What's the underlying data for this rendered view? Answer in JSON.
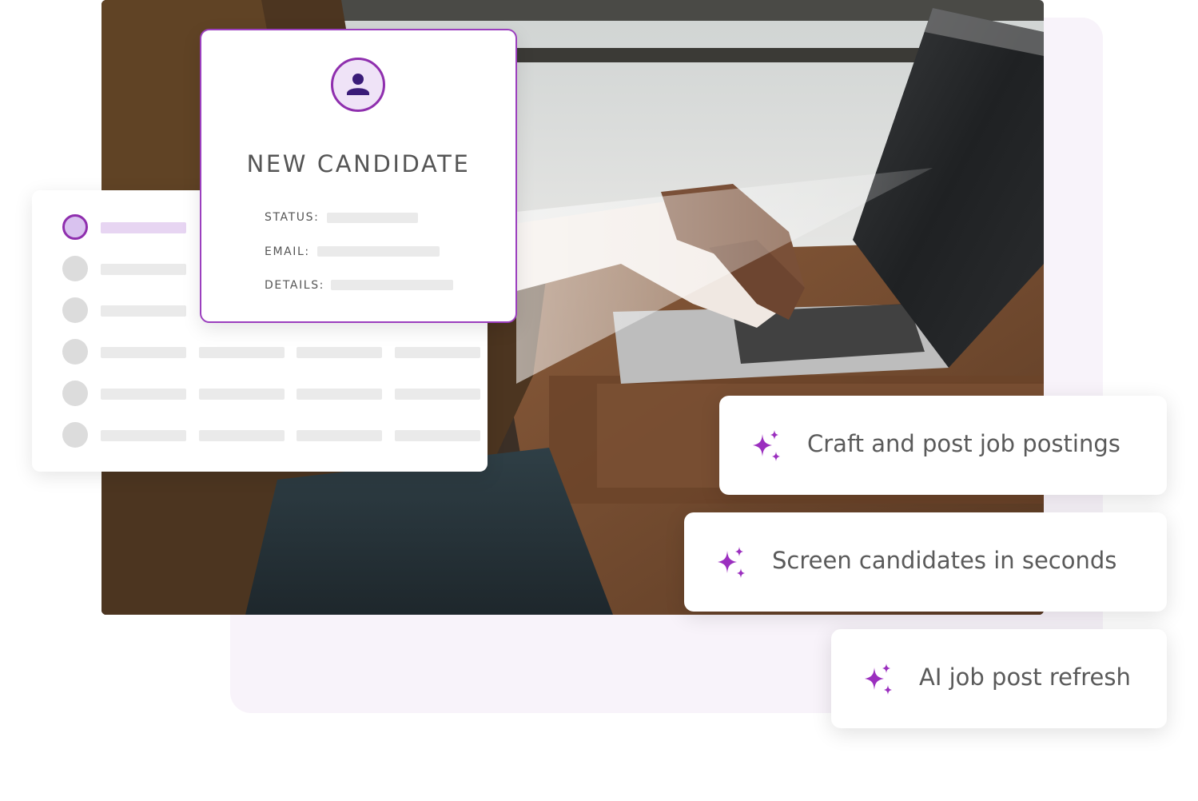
{
  "candidate_card": {
    "title": "NEW CANDIDATE",
    "fields": {
      "status_label": "STATUS:",
      "email_label": "EMAIL:",
      "details_label": "DETAILS:"
    },
    "icon": "user-icon"
  },
  "features": [
    {
      "label": "Craft and post job postings",
      "icon": "sparkles-icon"
    },
    {
      "label": "Screen candidates in seconds",
      "icon": "sparkles-icon"
    },
    {
      "label": "AI job post refresh",
      "icon": "sparkles-icon"
    }
  ],
  "colors": {
    "accent": "#8f2fae",
    "accent_light": "#efe3f7",
    "panel_bg": "#f8f3fa",
    "text": "#5a5a5a",
    "placeholder": "#eaeaea"
  }
}
